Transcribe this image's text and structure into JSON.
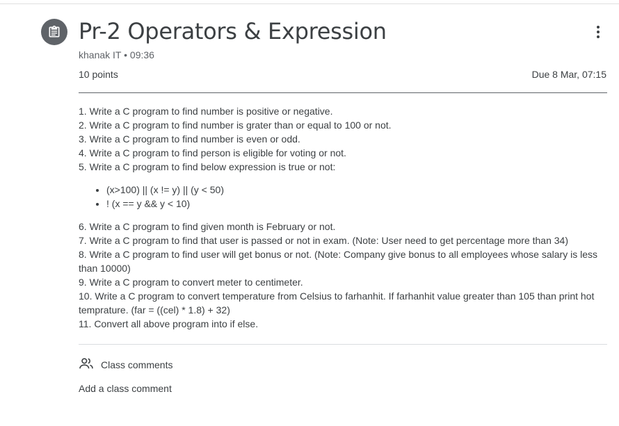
{
  "assignment": {
    "title": "Pr-2 Operators & Expression",
    "author": "khanak IT",
    "separator": "•",
    "time": "09:36",
    "points": "10 points",
    "due": "Due 8 Mar, 07:15"
  },
  "description": {
    "lines_before": [
      "1. Write a C program to find number is positive or negative.",
      "2. Write a C program to find number is grater than or equal to 100 or not.",
      "3. Write a C program to find number is even or odd.",
      "4. Write a C program to find person is eligible for voting or not.",
      "5. Write a C program to find below expression is true or not:"
    ],
    "bullets": [
      "(x>100) || (x != y) || (y < 50)",
      "! (x == y && y < 10)"
    ],
    "lines_after": [
      "6. Write a C program to find given month is February or not.",
      "7.  Write a C program to find that user is passed or not in exam. (Note: User need to get percentage more than 34)",
      "8.  Write a C program to find user will get bonus or not. (Note: Company give bonus to all employees whose salary is less than 10000)",
      "9.  Write a C program to convert meter to centimeter.",
      "10.  Write a C program to convert temperature from Celsius to farhanhit. If farhanhit value greater than 105 than print hot temprature. (far = ((cel) * 1.8) + 32)",
      "11. Convert all above program into if else."
    ]
  },
  "comments": {
    "label": "Class comments",
    "add_label": "Add a class comment"
  },
  "icons": {
    "assignment": "assignment-icon",
    "more": "more-vert-icon",
    "people": "people-icon"
  },
  "colors": {
    "icon_bg": "#5f6368",
    "text": "#3c4043",
    "muted": "#5f6368"
  }
}
